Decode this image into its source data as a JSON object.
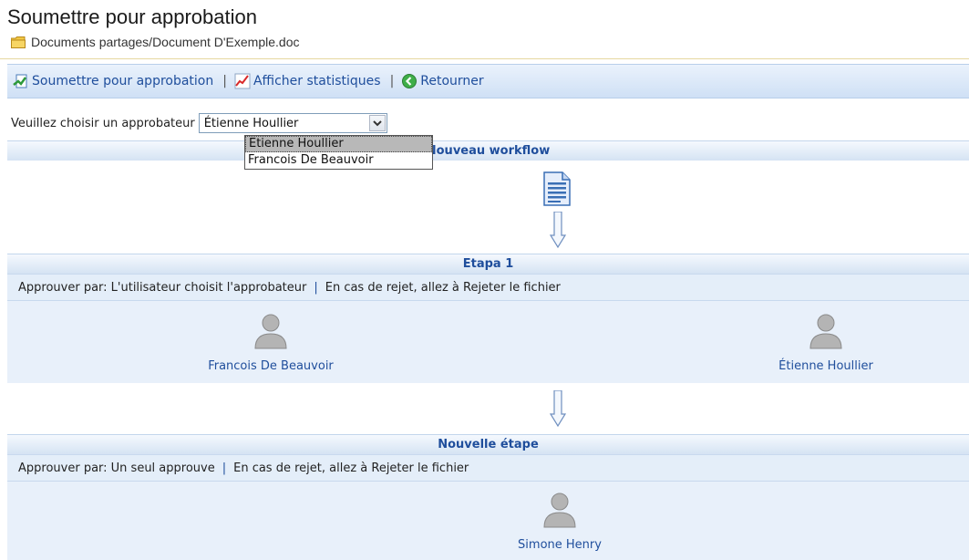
{
  "header": {
    "title": "Soumettre pour approbation",
    "path": "Documents partages/Document D'Exemple.doc"
  },
  "toolbar": {
    "submit_label": "Soumettre pour approbation",
    "stats_label": "Afficher statistiques",
    "back_label": "Retourner",
    "separator": "|"
  },
  "chooser": {
    "label": "Veuillez choisir un approbateur",
    "selected": "Étienne Houllier",
    "options": [
      "Etienne Houllier",
      "Francois De Beauvoir"
    ]
  },
  "workflow": {
    "start_title": "Nouveau workflow",
    "steps": [
      {
        "title": "Etapa 1",
        "approve_by": "Approuver par: L'utilisateur choisit l'approbateur",
        "on_reject": "En cas de rejet, allez à Rejeter le fichier",
        "approvers": [
          "Francois De Beauvoir",
          "Étienne Houllier"
        ]
      },
      {
        "title": "Nouvelle étape",
        "approve_by": "Approuver par: Un seul approuve",
        "on_reject": "En cas de rejet, allez à Rejeter le fichier",
        "approvers": [
          "Simone Henry"
        ]
      }
    ]
  },
  "colors": {
    "link": "#1f4e9c",
    "panel": "#e8f0fa",
    "toolbar": "#cfe0f5"
  }
}
